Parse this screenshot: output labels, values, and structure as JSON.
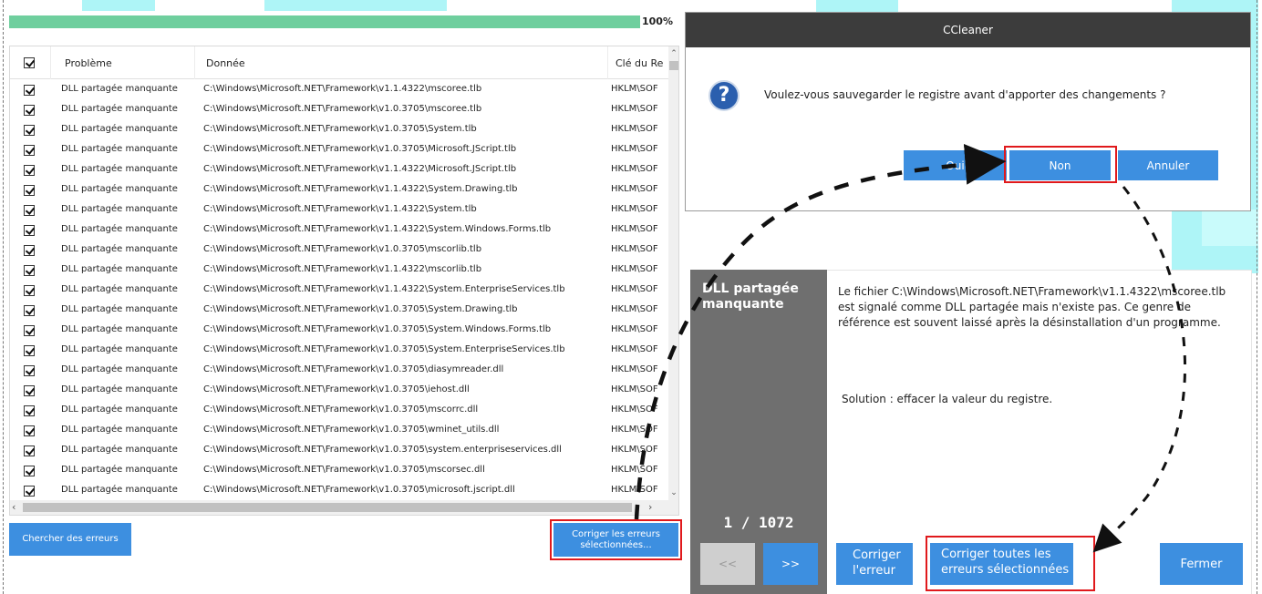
{
  "progress": {
    "percent": 100,
    "label": "100%"
  },
  "table": {
    "headers": {
      "problem": "Problème",
      "data": "Donnée",
      "key": "Clé du Re"
    },
    "rows": [
      {
        "problem": "DLL partagée manquante",
        "data": "C:\\Windows\\Microsoft.NET\\Framework\\v1.1.4322\\mscoree.tlb",
        "key": "HKLM\\SOF"
      },
      {
        "problem": "DLL partagée manquante",
        "data": "C:\\Windows\\Microsoft.NET\\Framework\\v1.0.3705\\mscoree.tlb",
        "key": "HKLM\\SOF"
      },
      {
        "problem": "DLL partagée manquante",
        "data": "C:\\Windows\\Microsoft.NET\\Framework\\v1.0.3705\\System.tlb",
        "key": "HKLM\\SOF"
      },
      {
        "problem": "DLL partagée manquante",
        "data": "C:\\Windows\\Microsoft.NET\\Framework\\v1.0.3705\\Microsoft.JScript.tlb",
        "key": "HKLM\\SOF"
      },
      {
        "problem": "DLL partagée manquante",
        "data": "C:\\Windows\\Microsoft.NET\\Framework\\v1.1.4322\\Microsoft.JScript.tlb",
        "key": "HKLM\\SOF"
      },
      {
        "problem": "DLL partagée manquante",
        "data": "C:\\Windows\\Microsoft.NET\\Framework\\v1.1.4322\\System.Drawing.tlb",
        "key": "HKLM\\SOF"
      },
      {
        "problem": "DLL partagée manquante",
        "data": "C:\\Windows\\Microsoft.NET\\Framework\\v1.1.4322\\System.tlb",
        "key": "HKLM\\SOF"
      },
      {
        "problem": "DLL partagée manquante",
        "data": "C:\\Windows\\Microsoft.NET\\Framework\\v1.1.4322\\System.Windows.Forms.tlb",
        "key": "HKLM\\SOF"
      },
      {
        "problem": "DLL partagée manquante",
        "data": "C:\\Windows\\Microsoft.NET\\Framework\\v1.0.3705\\mscorlib.tlb",
        "key": "HKLM\\SOF"
      },
      {
        "problem": "DLL partagée manquante",
        "data": "C:\\Windows\\Microsoft.NET\\Framework\\v1.1.4322\\mscorlib.tlb",
        "key": "HKLM\\SOF"
      },
      {
        "problem": "DLL partagée manquante",
        "data": "C:\\Windows\\Microsoft.NET\\Framework\\v1.1.4322\\System.EnterpriseServices.tlb",
        "key": "HKLM\\SOF"
      },
      {
        "problem": "DLL partagée manquante",
        "data": "C:\\Windows\\Microsoft.NET\\Framework\\v1.0.3705\\System.Drawing.tlb",
        "key": "HKLM\\SOF"
      },
      {
        "problem": "DLL partagée manquante",
        "data": "C:\\Windows\\Microsoft.NET\\Framework\\v1.0.3705\\System.Windows.Forms.tlb",
        "key": "HKLM\\SOF"
      },
      {
        "problem": "DLL partagée manquante",
        "data": "C:\\Windows\\Microsoft.NET\\Framework\\v1.0.3705\\System.EnterpriseServices.tlb",
        "key": "HKLM\\SOF"
      },
      {
        "problem": "DLL partagée manquante",
        "data": "C:\\Windows\\Microsoft.NET\\Framework\\v1.0.3705\\diasymreader.dll",
        "key": "HKLM\\SOF"
      },
      {
        "problem": "DLL partagée manquante",
        "data": "C:\\Windows\\Microsoft.NET\\Framework\\v1.0.3705\\iehost.dll",
        "key": "HKLM\\SOF"
      },
      {
        "problem": "DLL partagée manquante",
        "data": "C:\\Windows\\Microsoft.NET\\Framework\\v1.0.3705\\mscorrc.dll",
        "key": "HKLM\\SOF"
      },
      {
        "problem": "DLL partagée manquante",
        "data": "C:\\Windows\\Microsoft.NET\\Framework\\v1.0.3705\\wminet_utils.dll",
        "key": "HKLM\\SOF"
      },
      {
        "problem": "DLL partagée manquante",
        "data": "C:\\Windows\\Microsoft.NET\\Framework\\v1.0.3705\\system.enterpriseservices.dll",
        "key": "HKLM\\SOF"
      },
      {
        "problem": "DLL partagée manquante",
        "data": "C:\\Windows\\Microsoft.NET\\Framework\\v1.0.3705\\mscorsec.dll",
        "key": "HKLM\\SOF"
      },
      {
        "problem": "DLL partagée manquante",
        "data": "C:\\Windows\\Microsoft.NET\\Framework\\v1.0.3705\\microsoft.jscript.dll",
        "key": "HKLM\\SOF"
      }
    ]
  },
  "buttons": {
    "search": "Chercher des erreurs",
    "fix_selected_line1": "Corriger les erreurs",
    "fix_selected_line2": "sélectionnées..."
  },
  "dialog": {
    "title": "CCleaner",
    "icon": "question-icon",
    "message": "Voulez-vous sauvegarder le registre avant d'apporter des changements ?",
    "yes": "Oui",
    "no": "Non",
    "cancel": "Annuler"
  },
  "detail": {
    "title_line1": "DLL partagée",
    "title_line2": "manquante",
    "counter": "1 / 1072",
    "prev": "<<",
    "next": ">>",
    "description": "Le fichier C:\\Windows\\Microsoft.NET\\Framework\\v1.1.4322\\mscoree.tlb est signalé comme DLL partagée mais n'existe pas. Ce genre de référence est souvent laissé après la désinstallation d'un programme.",
    "solution": "Solution : effacer la valeur du registre.",
    "fix_one_line1": "Corriger",
    "fix_one_line2": "l'erreur",
    "fix_all_line1": "Corriger toutes les",
    "fix_all_line2": "erreurs sélectionnées",
    "close": "Fermer"
  },
  "colors": {
    "accent": "#3d8fe0",
    "highlight": "#e0191c",
    "progress": "#6fcf9e",
    "title_bar": "#3c3c3c",
    "side_panel": "#6f6f6f"
  }
}
